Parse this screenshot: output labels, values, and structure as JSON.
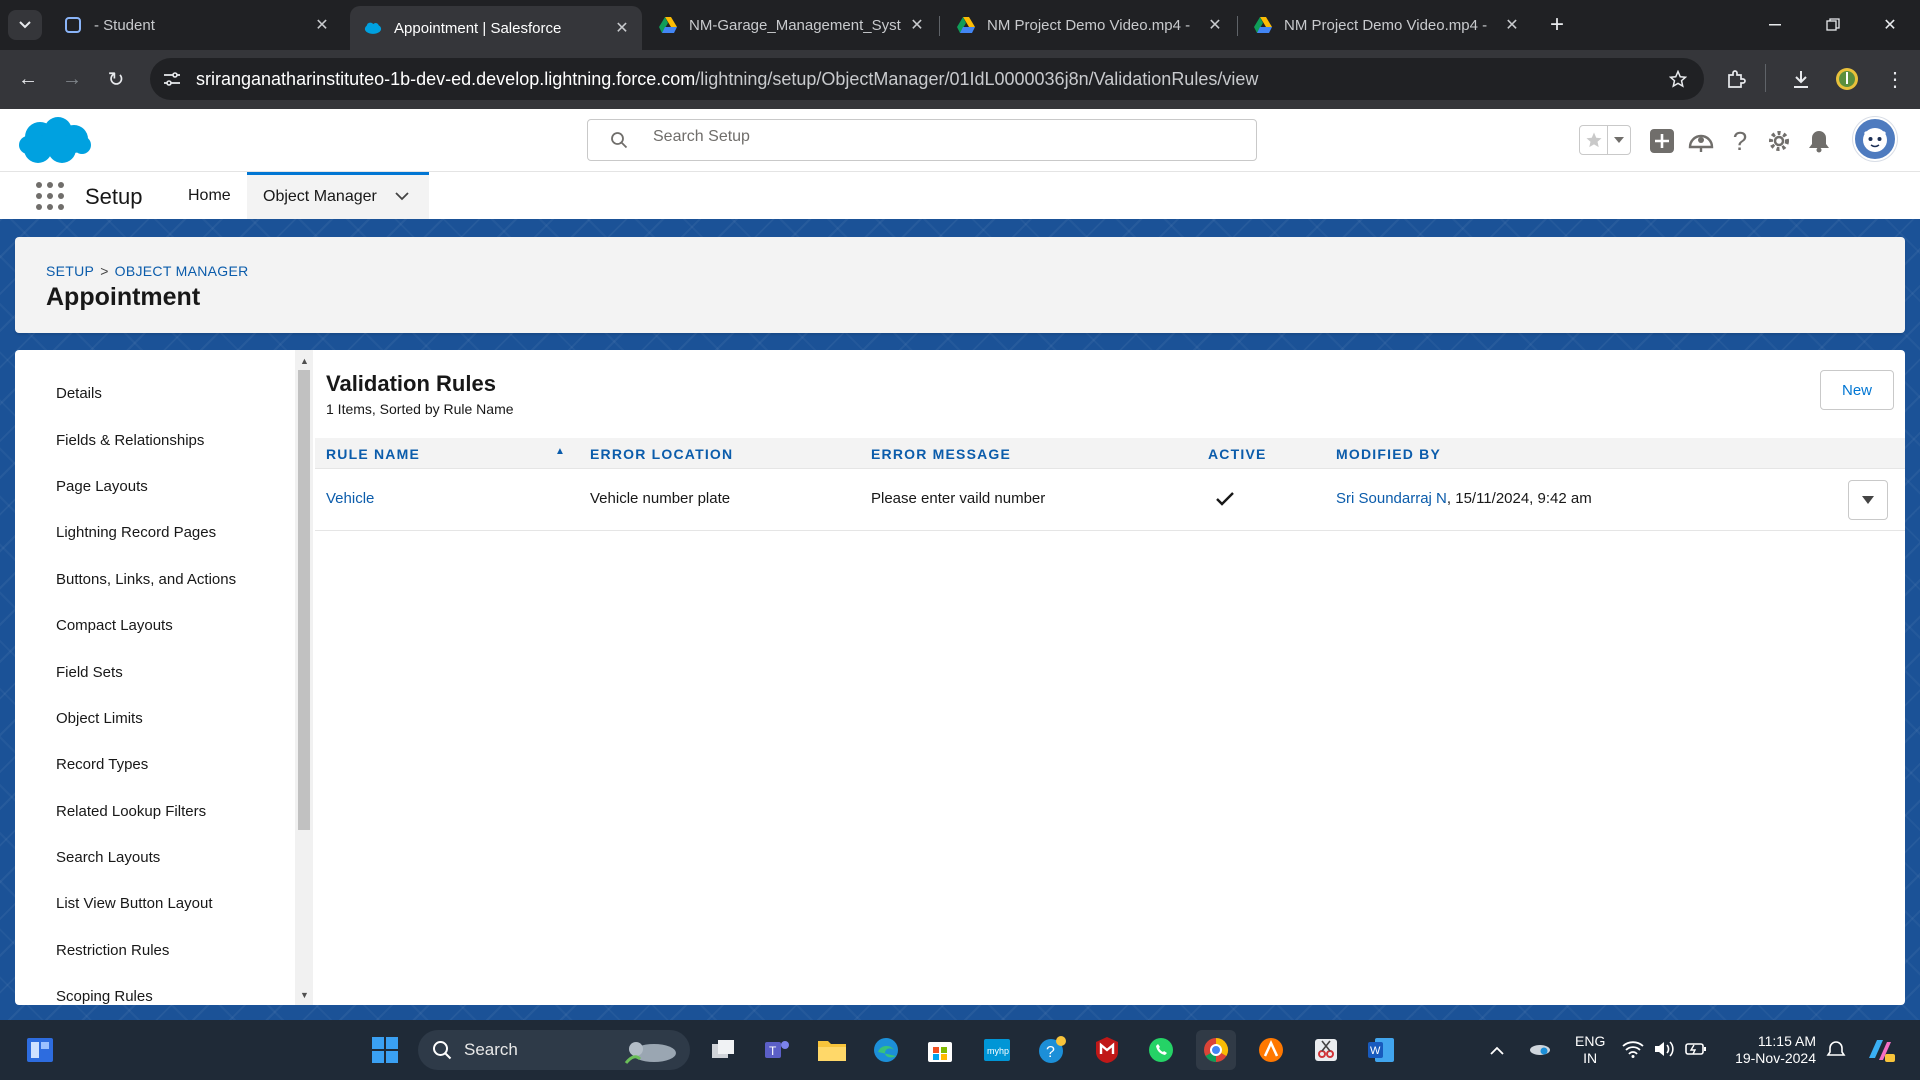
{
  "browser": {
    "tabs": [
      {
        "label": "- Student",
        "icon": "student-icon"
      },
      {
        "label": "Appointment | Salesforce",
        "icon": "salesforce-cloud-icon",
        "active": true
      },
      {
        "label": "NM-Garage_Management_Syst",
        "icon": "google-drive-icon"
      },
      {
        "label": "NM Project Demo Video.mp4 -",
        "icon": "google-drive-icon"
      },
      {
        "label": "NM Project Demo Video.mp4 -",
        "icon": "google-drive-icon"
      }
    ],
    "url_domain": "sriranganatharinstituteo-1b-dev-ed.develop.lightning.force.com",
    "url_path": "/lightning/setup/ObjectManager/01IdL0000036j8n/ValidationRules/view"
  },
  "sf_header": {
    "search_placeholder": "Search Setup",
    "brand_color": "#00a1e0"
  },
  "nav": {
    "app_name": "Setup",
    "tabs": [
      {
        "label": "Home"
      },
      {
        "label": "Object Manager",
        "selected": true
      }
    ]
  },
  "page_header": {
    "breadcrumb": [
      "SETUP",
      "OBJECT MANAGER"
    ],
    "breadcrumb_separator": ">",
    "title": "Appointment"
  },
  "left_nav": {
    "items": [
      "Details",
      "Fields & Relationships",
      "Page Layouts",
      "Lightning Record Pages",
      "Buttons, Links, and Actions",
      "Compact Layouts",
      "Field Sets",
      "Object Limits",
      "Record Types",
      "Related Lookup Filters",
      "Search Layouts",
      "List View Button Layout",
      "Restriction Rules",
      "Scoping Rules"
    ]
  },
  "validation_rules": {
    "title": "Validation Rules",
    "subtitle": "1 Items, Sorted by Rule Name",
    "new_button": "New",
    "columns": [
      "RULE NAME",
      "ERROR LOCATION",
      "ERROR MESSAGE",
      "ACTIVE",
      "MODIFIED BY"
    ],
    "rows": [
      {
        "rule_name": "Vehicle",
        "error_location": "Vehicle number plate",
        "error_message": "Please enter vaild number",
        "active": true,
        "modified_by_name": "Sri Soundarraj N",
        "modified_by_date": ", 15/11/2024, 9:42 am"
      }
    ]
  },
  "taskbar": {
    "search_label": "Search",
    "lang_top": "ENG",
    "lang_bottom": "IN",
    "time": "11:15 AM",
    "date": "19-Nov-2024"
  },
  "colors": {
    "accent_blue": "#0176d3",
    "link_blue": "#0b5cab",
    "band_blue": "#1b5297"
  }
}
